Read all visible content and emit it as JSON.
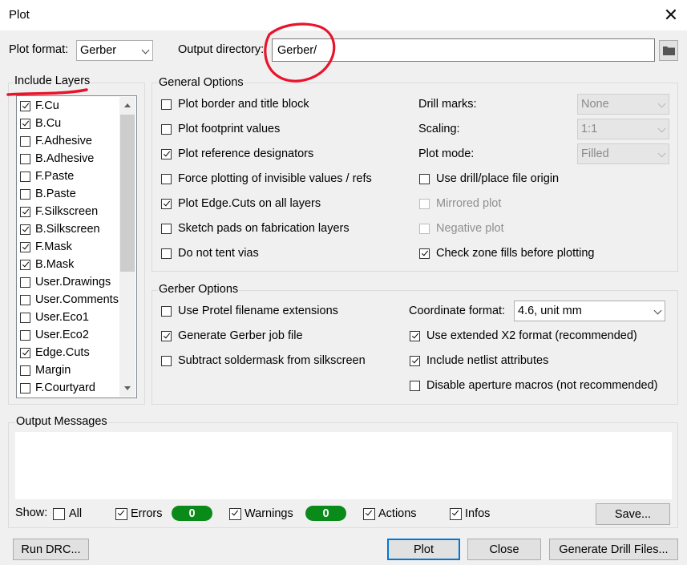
{
  "window": {
    "title": "Plot"
  },
  "header": {
    "plot_format_label": "Plot format:",
    "plot_format_value": "Gerber",
    "output_dir_label": "Output directory:",
    "output_dir_value": "Gerber/"
  },
  "layers": {
    "title": "Include Layers",
    "items": [
      {
        "label": "F.Cu",
        "checked": true
      },
      {
        "label": "B.Cu",
        "checked": true
      },
      {
        "label": "F.Adhesive",
        "checked": false
      },
      {
        "label": "B.Adhesive",
        "checked": false
      },
      {
        "label": "F.Paste",
        "checked": false
      },
      {
        "label": "B.Paste",
        "checked": false
      },
      {
        "label": "F.Silkscreen",
        "checked": true
      },
      {
        "label": "B.Silkscreen",
        "checked": true
      },
      {
        "label": "F.Mask",
        "checked": true
      },
      {
        "label": "B.Mask",
        "checked": true
      },
      {
        "label": "User.Drawings",
        "checked": false
      },
      {
        "label": "User.Comments",
        "checked": false
      },
      {
        "label": "User.Eco1",
        "checked": false
      },
      {
        "label": "User.Eco2",
        "checked": false
      },
      {
        "label": "Edge.Cuts",
        "checked": true
      },
      {
        "label": "Margin",
        "checked": false
      },
      {
        "label": "F.Courtyard",
        "checked": false
      }
    ]
  },
  "general": {
    "title": "General Options",
    "plot_border": "Plot border and title block",
    "plot_fp_values": "Plot footprint values",
    "plot_ref_des": "Plot reference designators",
    "force_invisible": "Force plotting of invisible values / refs",
    "plot_edge_cuts": "Plot Edge.Cuts on all layers",
    "sketch_pads": "Sketch pads on fabrication layers",
    "no_tent_vias": "Do not tent vias",
    "drill_marks_label": "Drill marks:",
    "drill_marks_value": "None",
    "scaling_label": "Scaling:",
    "scaling_value": "1:1",
    "plot_mode_label": "Plot mode:",
    "plot_mode_value": "Filled",
    "use_drill_origin": "Use drill/place file origin",
    "mirrored_plot": "Mirrored plot",
    "negative_plot": "Negative plot",
    "check_zone_fills": "Check zone fills before plotting"
  },
  "gerber": {
    "title": "Gerber Options",
    "protel_ext": "Use Protel filename extensions",
    "gen_job_file": "Generate Gerber job file",
    "subtract_mask": "Subtract soldermask from silkscreen",
    "coord_format_label": "Coordinate format:",
    "coord_format_value": "4.6, unit mm",
    "extended_x2": "Use extended X2 format (recommended)",
    "netlist_attrs": "Include netlist attributes",
    "disable_aperture": "Disable aperture macros (not recommended)"
  },
  "messages": {
    "title": "Output Messages",
    "show_label": "Show:",
    "all": "All",
    "errors": "Errors",
    "errors_count": "0",
    "warnings": "Warnings",
    "warnings_count": "0",
    "actions": "Actions",
    "infos": "Infos",
    "save": "Save..."
  },
  "footer": {
    "run_drc": "Run DRC...",
    "plot": "Plot",
    "close": "Close",
    "gen_drill": "Generate Drill Files..."
  },
  "colors": {
    "annotation": "#e8142b",
    "count_badge": "#0a8a18",
    "default_button_border": "#0078d7"
  }
}
